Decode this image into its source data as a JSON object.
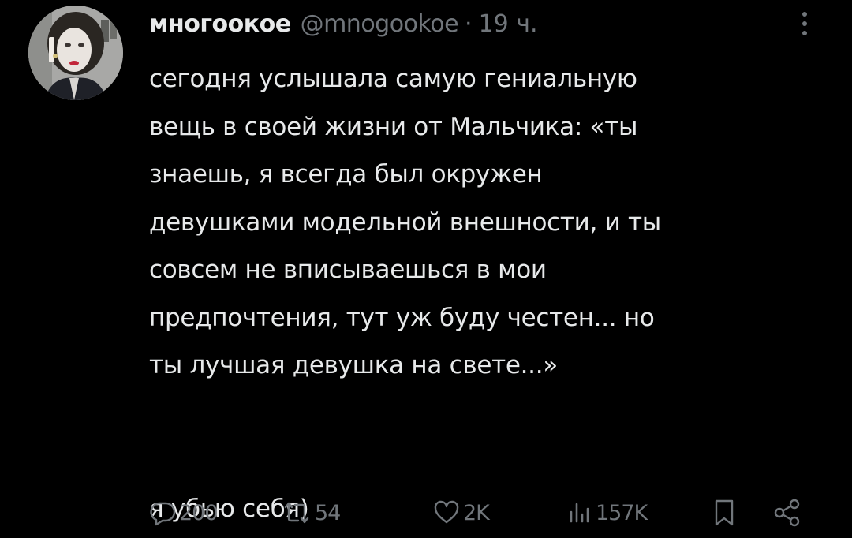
{
  "tweet": {
    "author_name": "многоокое",
    "author_handle": "@mnogookoe",
    "separator": "·",
    "time": "19 ч.",
    "text_lines": [
      "сегодня услышала самую гениальную",
      "вещь в своей жизни от Мальчика: «ты",
      "знаешь, я всегда был окружен",
      "девушками модельной внешности, и ты",
      "совсем не вписываешься в мои",
      "предпочтения, тут уж буду честен... но",
      "ты лучшая девушка на свете...»"
    ],
    "closing_line": "я убью себя)"
  },
  "actions": {
    "replies": "200",
    "retweets": "54",
    "likes": "2K",
    "views": "157K"
  },
  "icons": {
    "more": "vertical-ellipsis-icon",
    "reply": "speech-bubble-icon",
    "retweet": "retweet-arrows-icon",
    "like": "heart-icon",
    "views": "bar-chart-icon",
    "bookmark": "bookmark-icon",
    "share": "share-icon"
  },
  "colors": {
    "background": "#000000",
    "primary_text": "#e7e9ea",
    "secondary_text": "#71767b"
  }
}
